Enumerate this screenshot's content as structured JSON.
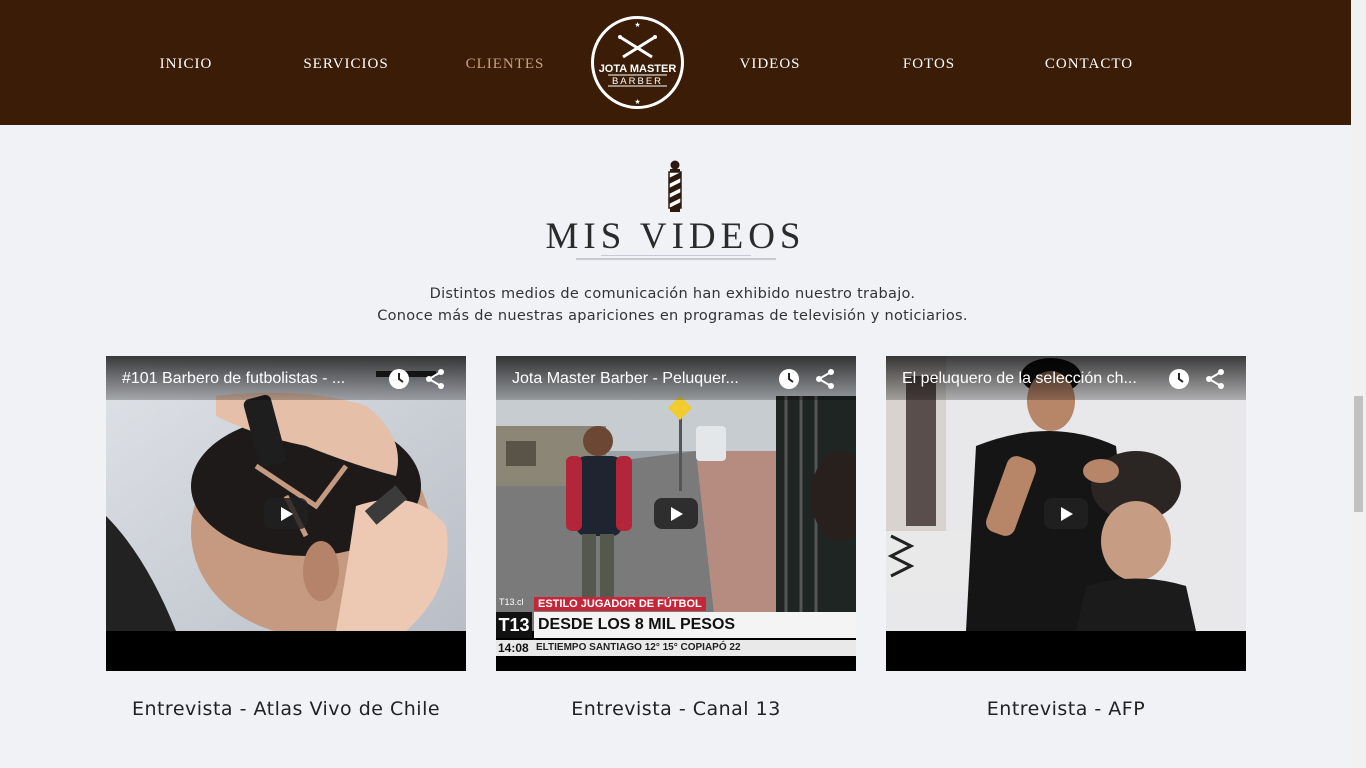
{
  "nav": {
    "items": [
      {
        "label": "INICIO",
        "active": false
      },
      {
        "label": "SERVICIOS",
        "active": false
      },
      {
        "label": "CLIENTES",
        "active": true
      },
      {
        "label": "VIDEOS",
        "active": false
      },
      {
        "label": "FOTOS",
        "active": false
      },
      {
        "label": "CONTACTO",
        "active": false
      }
    ],
    "logo": {
      "line1": "JOTA MASTER",
      "line2": "BARBER"
    }
  },
  "section": {
    "title": "MIS VIDEOS",
    "intro_line1": "Distintos medios de comunicación han exhibido nuestro trabajo.",
    "intro_line2": "Conoce más de nuestras apariciones en programas de televisión y noticiarios."
  },
  "videos": [
    {
      "title": "#101 Barbero de futbolistas - ...",
      "caption": "Entrevista - Atlas Vivo de Chile"
    },
    {
      "title": "Jota Master Barber - Peluquer...",
      "caption": "Entrevista - Canal 13",
      "news": {
        "channel_small": "T13.cl",
        "channel": "T13",
        "tag": "ESTILO JUGADOR DE FÚTBOL",
        "headline": "DESDE LOS 8 MIL PESOS",
        "time": "14:08",
        "ticker": "ELTIEMPO   SANTIAGO   12°  15°      COPIAPÓ      22"
      }
    },
    {
      "title": "El peluquero de la selección ch...",
      "caption": "Entrevista - AFP"
    }
  ],
  "colors": {
    "nav_bg": "#3a1c07",
    "nav_text": "#ffffff",
    "nav_active": "#c9a27e",
    "page_bg": "#f1f2f6"
  }
}
